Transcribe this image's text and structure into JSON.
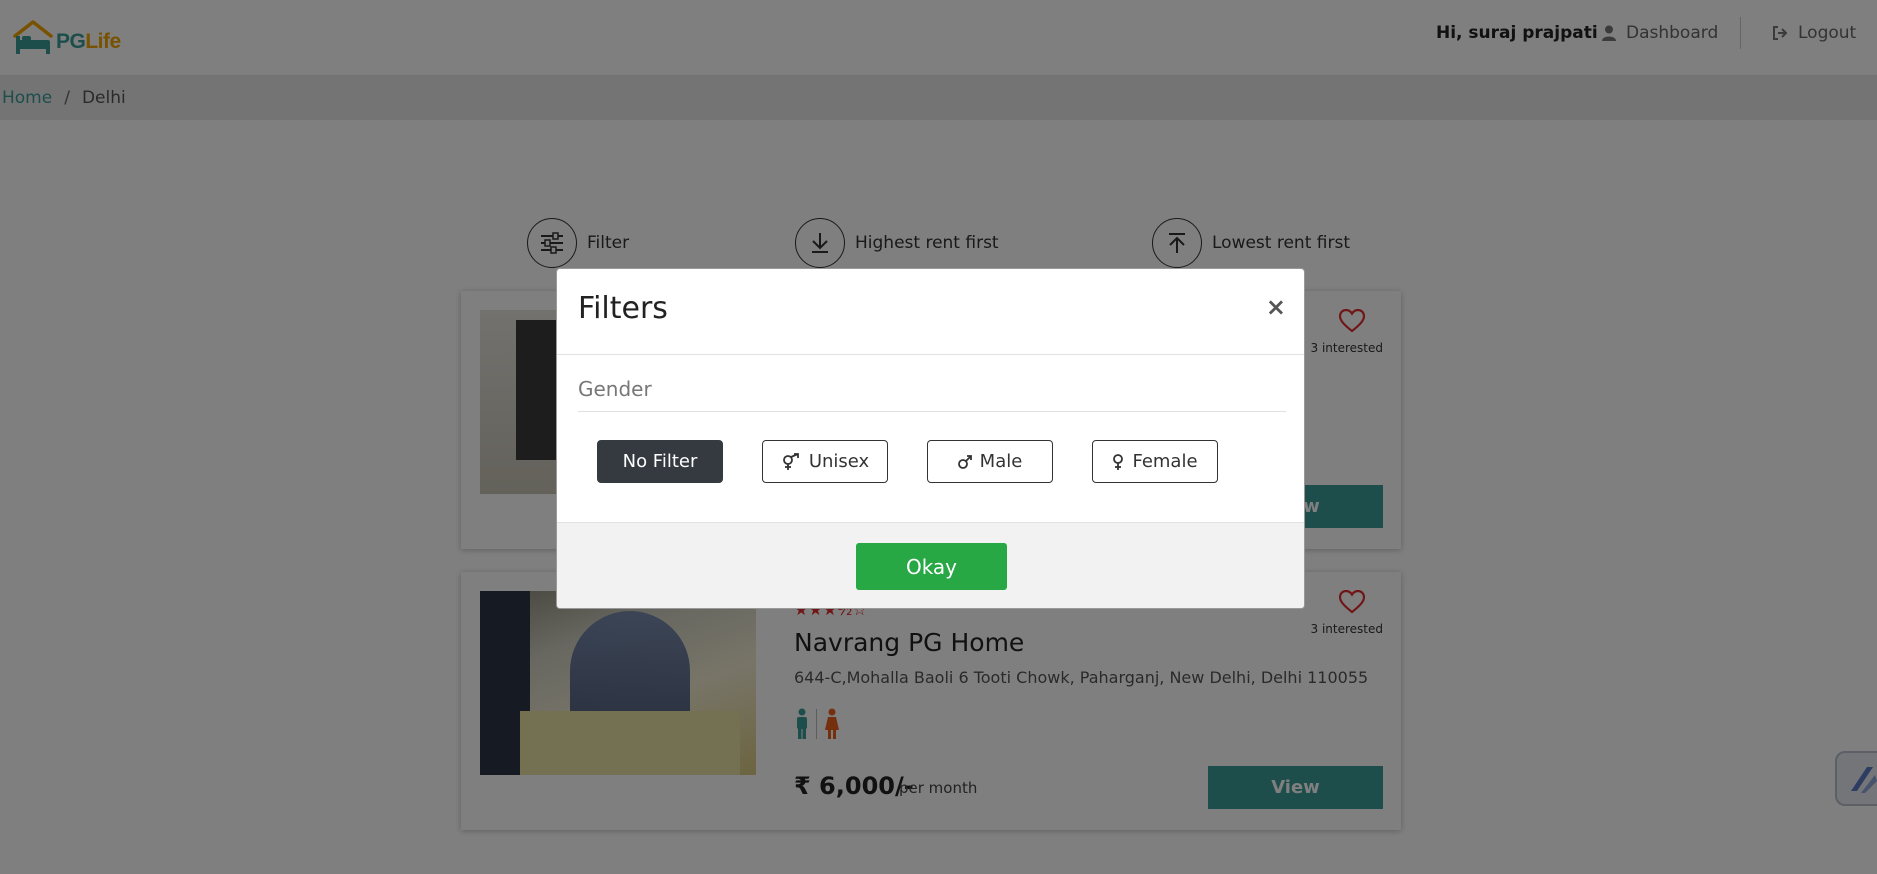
{
  "header": {
    "logo_pg": "PG",
    "logo_life": "Life",
    "greeting": "Hi, suraj prajpati",
    "dashboard_label": "Dashboard",
    "logout_label": "Logout"
  },
  "breadcrumb": {
    "home": "Home",
    "separator": "/",
    "current": "Delhi"
  },
  "sort_bar": {
    "filter_label": "Filter",
    "highest_label": "Highest rent first",
    "lowest_label": "Lowest rent first"
  },
  "cards": [
    {
      "interested": "3 interested",
      "view_label": "View"
    },
    {
      "rating_stars": "★★★½☆",
      "title": "Navrang PG Home",
      "address": "644-C,Mohalla Baoli 6 Tooti Chowk, Paharganj, New Delhi, Delhi 110055",
      "interested": "3 interested",
      "price": "₹ 6,000/-",
      "per_month": "per month",
      "view_label": "View"
    }
  ],
  "modal": {
    "title": "Filters",
    "close_label": "×",
    "gender_label": "Gender",
    "options": {
      "no_filter": "No Filter",
      "unisex": "Unisex",
      "male": "Male",
      "female": "Female"
    },
    "okay_label": "Okay"
  },
  "colors": {
    "brand_teal": "#3a9d96",
    "brand_orange": "#f0a500",
    "okay_green": "#28a745",
    "active_dark": "#343a40",
    "heart_red": "#e02d2d"
  }
}
